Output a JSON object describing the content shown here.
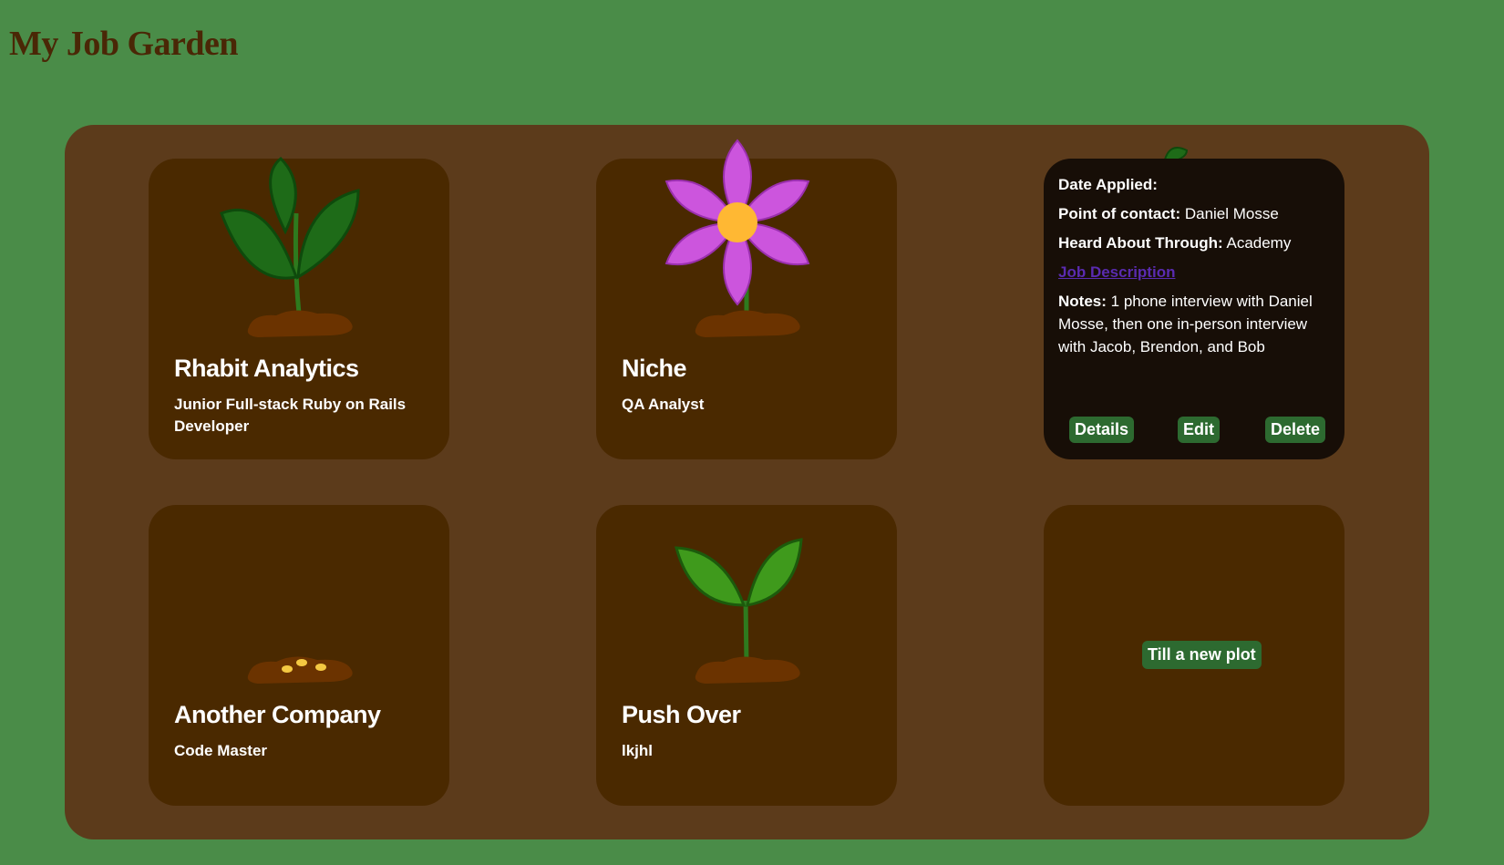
{
  "app": {
    "title": "My Job Garden"
  },
  "plots": [
    {
      "company": "Rhabit Analytics",
      "role": "Junior Full-stack Ruby on Rails Developer",
      "plant_stage": "leafy-plant"
    },
    {
      "company": "Niche",
      "role": "QA Analyst",
      "plant_stage": "flower"
    },
    {
      "company": "Another Company",
      "role": "Code Master",
      "plant_stage": "seeds"
    },
    {
      "company": "Push Over",
      "role": "lkjhl",
      "plant_stage": "sprout"
    }
  ],
  "details_card": {
    "date_applied_label": "Date Applied:",
    "date_applied_value": "",
    "contact_label": "Point of contact:",
    "contact_value": "Daniel Mosse",
    "heard_label": "Heard About Through:",
    "heard_value": "Academy",
    "job_description_link": "Job Description",
    "notes_label": "Notes:",
    "notes_value": "1 phone interview with Daniel Mosse, then one in-person interview with Jacob, Brendon, and Bob",
    "details_button": "Details",
    "edit_button": "Edit",
    "delete_button": "Delete"
  },
  "new_plot": {
    "button_label": "Till a new plot"
  },
  "colors": {
    "background": "#4a8c48",
    "garden": "#5c3b1b",
    "plot": "#4a2900",
    "details_card": "#170e07",
    "button": "#2d6a30",
    "title": "#4a2706",
    "flower_petal": "#cc55dd",
    "flower_center": "#ffb833",
    "leaf": "#1f6b1a",
    "soil": "#6b3300"
  }
}
